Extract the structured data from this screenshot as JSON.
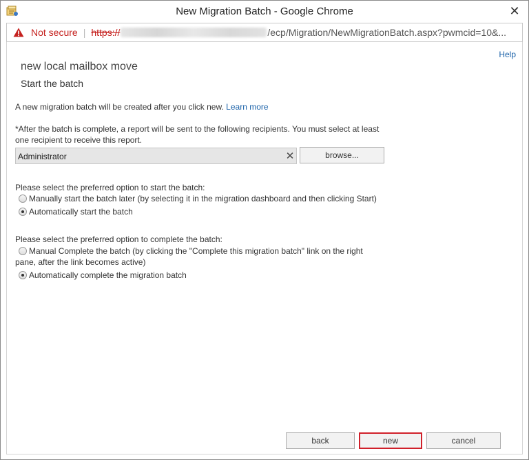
{
  "window": {
    "title": "New Migration Batch - Google Chrome",
    "close_label": "✕"
  },
  "addressbar": {
    "security_label": "Not secure",
    "url_protocol": "https://",
    "url_path": "/ecp/Migration/NewMigrationBatch.aspx?pwmcid=10&..."
  },
  "page": {
    "help_label": "Help",
    "title": "new local mailbox move",
    "subtitle": "Start the batch",
    "info_text": "A new migration batch will be created after you click new.",
    "learn_more": "Learn more",
    "recipients_text_1": "*After the batch is complete, a report will be sent to the following recipients. You must select at least",
    "recipients_text_2": "one recipient to receive this report.",
    "recipient_value": "Administrator",
    "clear_label": "✕",
    "browse_label": "browse...",
    "start_prompt": "Please select the preferred option to start the batch:",
    "start_options": [
      {
        "label": "Manually start the batch later (by selecting it in the migration dashboard and then clicking Start)",
        "checked": false
      },
      {
        "label": "Automatically start the batch",
        "checked": true
      }
    ],
    "complete_prompt": "Please select the preferred option to complete the batch:",
    "complete_options": [
      {
        "label_1": "Manual Complete the batch (by clicking the \"Complete this migration batch\" link on the right",
        "label_2": "pane, after the link becomes active)",
        "checked": false
      },
      {
        "label": "Automatically complete the migration batch",
        "checked": true
      }
    ]
  },
  "footer": {
    "back_label": "back",
    "new_label": "new",
    "cancel_label": "cancel"
  },
  "colors": {
    "link": "#1a61a8",
    "warning": "#c5221f",
    "highlight_border": "#d0202a"
  }
}
